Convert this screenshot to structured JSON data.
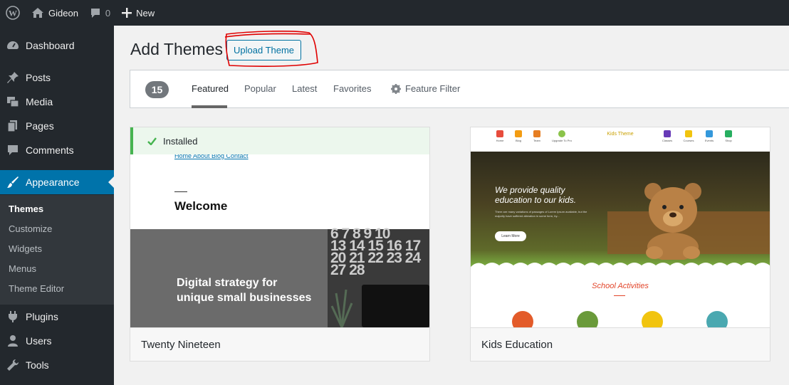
{
  "admin_bar": {
    "site_name": "Gideon",
    "comments_count": "0",
    "new_label": "New"
  },
  "sidebar": {
    "items": [
      {
        "label": "Dashboard",
        "icon": "dashboard-icon"
      },
      {
        "label": "Posts",
        "icon": "pin-icon"
      },
      {
        "label": "Media",
        "icon": "media-icon"
      },
      {
        "label": "Pages",
        "icon": "pages-icon"
      },
      {
        "label": "Comments",
        "icon": "comments-icon"
      },
      {
        "label": "Appearance",
        "icon": "paintbrush-icon",
        "active": true
      },
      {
        "label": "Plugins",
        "icon": "plugins-icon"
      },
      {
        "label": "Users",
        "icon": "users-icon"
      },
      {
        "label": "Tools",
        "icon": "tools-icon"
      }
    ],
    "submenu": [
      "Themes",
      "Customize",
      "Widgets",
      "Menus",
      "Theme Editor"
    ]
  },
  "main": {
    "title": "Add Themes",
    "upload_button": "Upload Theme",
    "theme_count": "15",
    "filters": [
      "Featured",
      "Popular",
      "Latest",
      "Favorites"
    ],
    "current_filter": "Featured",
    "feature_filter": "Feature Filter"
  },
  "themes": [
    {
      "name": "Twenty Nineteen",
      "installed_notice": "Installed",
      "preview": {
        "nav": "Home About Blog Contact",
        "welcome": "Welcome",
        "heading_line1": "Digital strategy for",
        "heading_line2": "unique small businesses",
        "calendar_row1": "6 7 8 9 10",
        "calendar_row2": "13 14 15 16 17",
        "calendar_row3": "20 21 22 23 24",
        "calendar_row4": "27 28"
      }
    },
    {
      "name": "Kids Education",
      "preview": {
        "nav_left": [
          "Home",
          "Blog",
          "Team",
          "Upgrade To Pro"
        ],
        "logo": "Kids Theme",
        "nav_right": [
          "Classes",
          "Courses",
          "Events",
          "Shop"
        ],
        "hero_line1": "We provide quality",
        "hero_line2": "education to our kids.",
        "hero_small": "There are many variations of passages of Lorem Ipsum available, but the majority have suffered alteration in some form, by...",
        "hero_button": "Learn More",
        "activities": "School Activities"
      }
    }
  ],
  "colors": {
    "admin_bar": "#23282d",
    "accent": "#0073aa",
    "installed_green": "#46b450",
    "annotation_red": "#e00000"
  }
}
